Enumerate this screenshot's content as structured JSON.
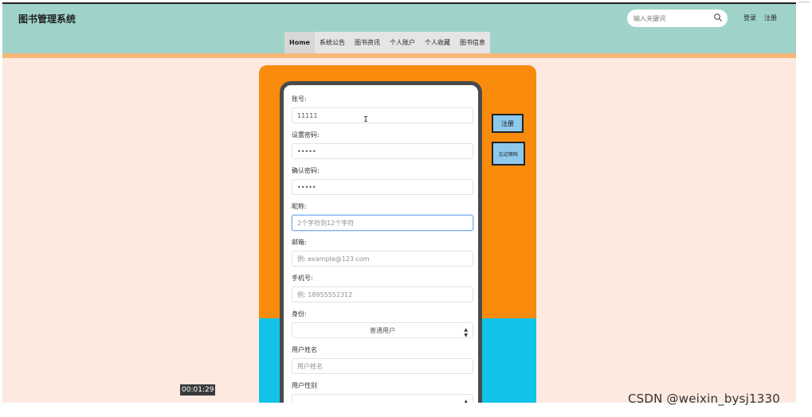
{
  "site": {
    "title": "图书管理系统"
  },
  "search": {
    "placeholder": "输入关键词"
  },
  "auth": {
    "login": "登录",
    "register": "注册"
  },
  "nav": {
    "items": [
      "Home",
      "系统公告",
      "图书资讯",
      "个人账户",
      "个人收藏",
      "图书信息"
    ],
    "active": "Home"
  },
  "form": {
    "fields": [
      {
        "label": "账号:",
        "value": "11111",
        "placeholder": ""
      },
      {
        "label": "设置密码:",
        "value": "•••••",
        "placeholder": ""
      },
      {
        "label": "确认密码:",
        "value": "•••••",
        "placeholder": ""
      },
      {
        "label": "昵称:",
        "value": "",
        "placeholder": "2个字符到12个字符"
      },
      {
        "label": "邮箱:",
        "value": "",
        "placeholder": "例: example@123.com"
      },
      {
        "label": "手机号:",
        "value": "",
        "placeholder": "例: 18955552312"
      },
      {
        "label": "身份:",
        "value": "普通用户",
        "placeholder": ""
      },
      {
        "label": "用户姓名",
        "value": "",
        "placeholder": "用户姓名"
      },
      {
        "label": "用户性别",
        "value": "",
        "placeholder": ""
      }
    ]
  },
  "buttons": {
    "register": "注册",
    "forgot_password": "忘记密码"
  },
  "overlay": {
    "timestamp": "00:01:29",
    "watermark": "CSDN @weixin_bysj1330"
  },
  "colors": {
    "header": "#9fd3c9",
    "panel_orange": "#f88b0c",
    "panel_blue": "#12c3e8",
    "page_bg": "#fde9e0",
    "button": "#8ec9ec"
  }
}
